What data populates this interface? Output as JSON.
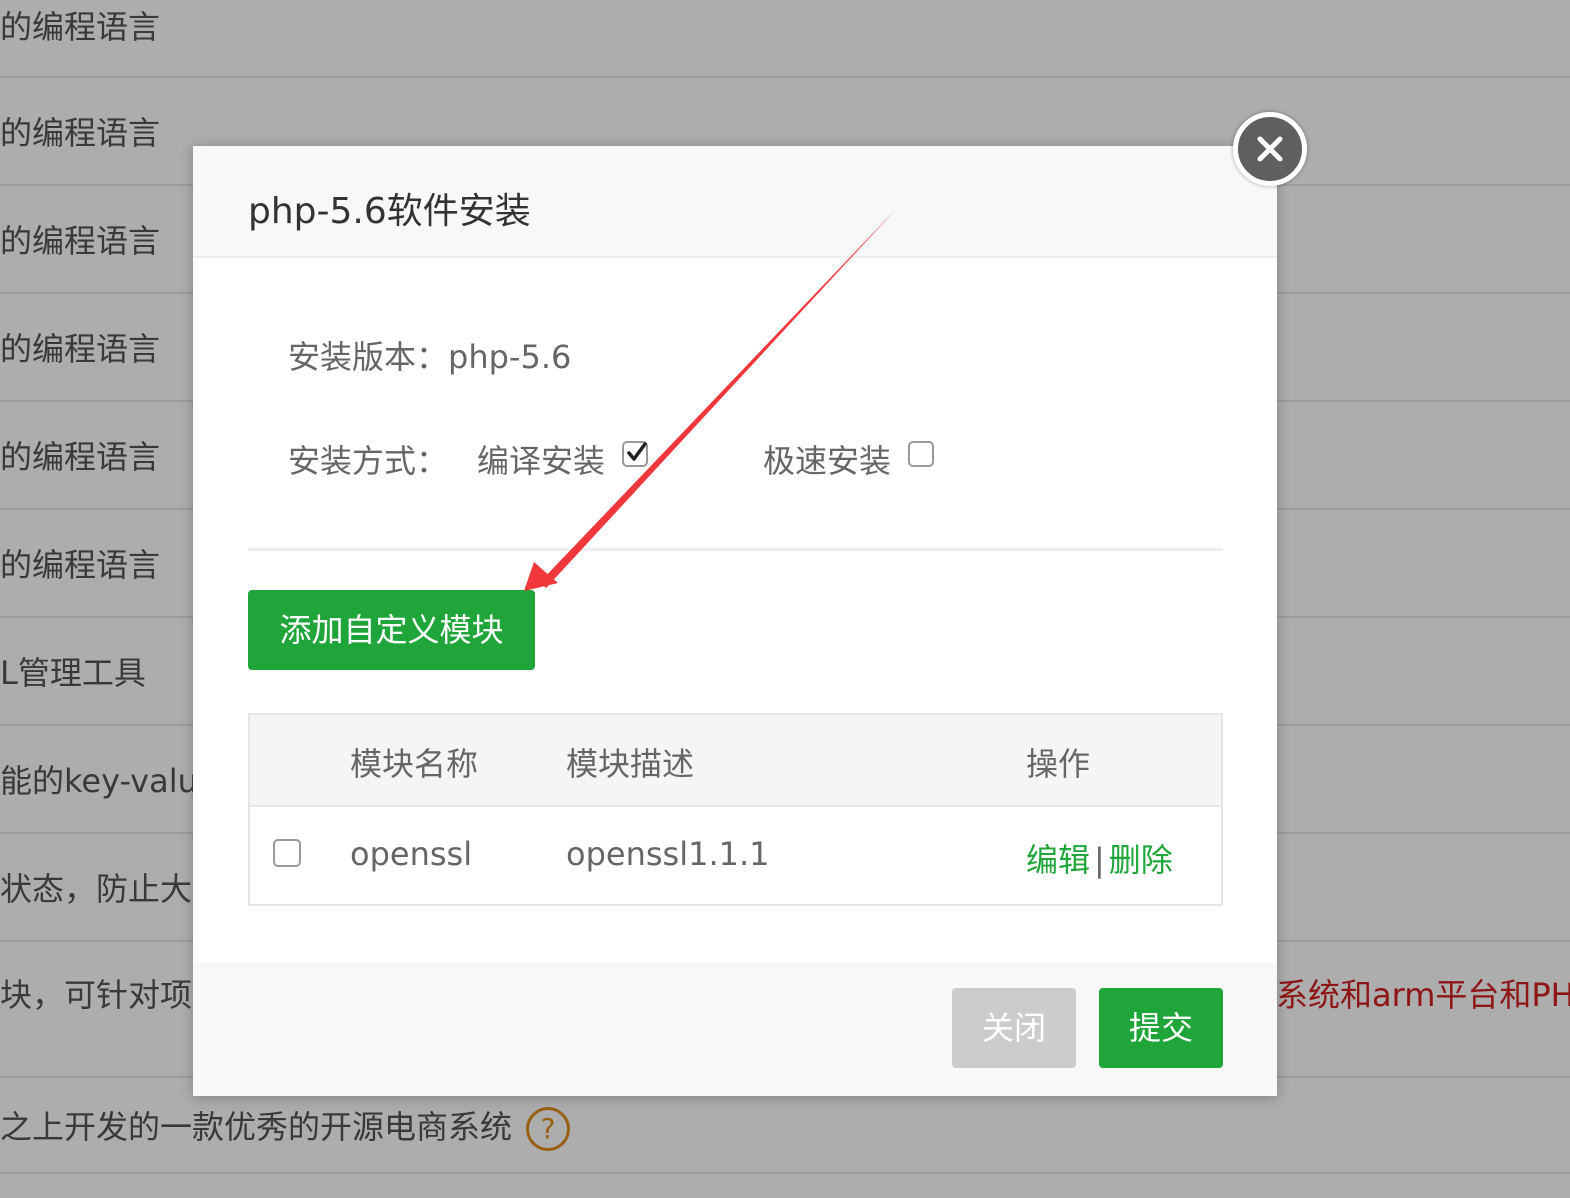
{
  "background": {
    "rows": [
      "的编程语言",
      "的编程语言",
      "的编程语言",
      "的编程语言",
      "的编程语言",
      "的编程语言",
      "L管理工具",
      "能的key-value",
      "状态，防止大",
      "块，可针对项目",
      "之上开发的一款优秀的开源电商系统"
    ],
    "red_text": "系统和arm平台和PH",
    "help_icon_glyph": "?"
  },
  "modal": {
    "title": "php-5.6软件安装",
    "version_label": "安装版本：",
    "version_value": "php-5.6",
    "method_label": "安装方式：",
    "option_compile": "编译安装",
    "option_compile_checked": true,
    "option_fast": "极速安装",
    "option_fast_checked": false,
    "add_module_button": "添加自定义模块",
    "table": {
      "headers": [
        "模块名称",
        "模块描述",
        "操作"
      ],
      "rows": [
        {
          "name": "openssl",
          "description": "openssl1.1.1",
          "edit": "编辑",
          "separator": "|",
          "delete": "删除"
        }
      ]
    },
    "close_button": "关闭",
    "submit_button": "提交"
  },
  "colors": {
    "accent_green": "#20a53a",
    "annotation_red": "#f0373c",
    "warning_text_red": "#d21f1f"
  }
}
